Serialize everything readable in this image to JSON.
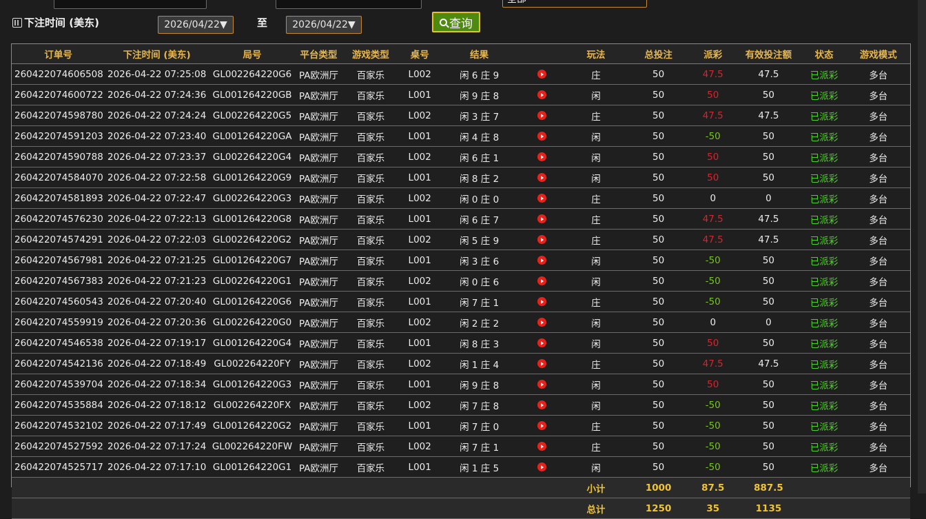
{
  "top": {
    "select_value": "全部"
  },
  "filter": {
    "date_label": "下注时间 (美东)",
    "start_date": "2026/04/22",
    "to_label": "至",
    "end_date": "2026/04/22",
    "query_label": "查询"
  },
  "columns": [
    "订单号",
    "下注时间 (美东)",
    "局号",
    "平台类型",
    "游戏类型",
    "桌号",
    "结果",
    "",
    "玩法",
    "总投注",
    "派彩",
    "有效投注额",
    "状态",
    "游戏模式"
  ],
  "rows": [
    {
      "order": "260422074606508",
      "time": "2026-04-22 07:25:08",
      "round": "GL002264220G6",
      "platform": "PA欧洲厅",
      "game": "百家乐",
      "table": "L002",
      "result": "闲 6 庄 9",
      "play": "庄",
      "bet": "50",
      "payout": "47.5",
      "payout_color": "red",
      "valid": "47.5",
      "status": "已派彩",
      "mode": "多台"
    },
    {
      "order": "260422074600722",
      "time": "2026-04-22 07:24:36",
      "round": "GL001264220GB",
      "platform": "PA欧洲厅",
      "game": "百家乐",
      "table": "L001",
      "result": "闲 9 庄 8",
      "play": "闲",
      "bet": "50",
      "payout": "50",
      "payout_color": "red",
      "valid": "50",
      "status": "已派彩",
      "mode": "多台"
    },
    {
      "order": "260422074598780",
      "time": "2026-04-22 07:24:24",
      "round": "GL002264220G5",
      "platform": "PA欧洲厅",
      "game": "百家乐",
      "table": "L002",
      "result": "闲 3 庄 7",
      "play": "庄",
      "bet": "50",
      "payout": "47.5",
      "payout_color": "red",
      "valid": "47.5",
      "status": "已派彩",
      "mode": "多台"
    },
    {
      "order": "260422074591203",
      "time": "2026-04-22 07:23:40",
      "round": "GL001264220GA",
      "platform": "PA欧洲厅",
      "game": "百家乐",
      "table": "L001",
      "result": "闲 4 庄 8",
      "play": "闲",
      "bet": "50",
      "payout": "-50",
      "payout_color": "green",
      "valid": "50",
      "status": "已派彩",
      "mode": "多台"
    },
    {
      "order": "260422074590788",
      "time": "2026-04-22 07:23:37",
      "round": "GL002264220G4",
      "platform": "PA欧洲厅",
      "game": "百家乐",
      "table": "L002",
      "result": "闲 6 庄 1",
      "play": "闲",
      "bet": "50",
      "payout": "50",
      "payout_color": "red",
      "valid": "50",
      "status": "已派彩",
      "mode": "多台"
    },
    {
      "order": "260422074584070",
      "time": "2026-04-22 07:22:58",
      "round": "GL001264220G9",
      "platform": "PA欧洲厅",
      "game": "百家乐",
      "table": "L001",
      "result": "闲 8 庄 2",
      "play": "闲",
      "bet": "50",
      "payout": "50",
      "payout_color": "red",
      "valid": "50",
      "status": "已派彩",
      "mode": "多台"
    },
    {
      "order": "260422074581893",
      "time": "2026-04-22 07:22:47",
      "round": "GL002264220G3",
      "platform": "PA欧洲厅",
      "game": "百家乐",
      "table": "L002",
      "result": "闲 0 庄 0",
      "play": "庄",
      "bet": "50",
      "payout": "0",
      "payout_color": "white",
      "valid": "0",
      "status": "已派彩",
      "mode": "多台"
    },
    {
      "order": "260422074576230",
      "time": "2026-04-22 07:22:13",
      "round": "GL001264220G8",
      "platform": "PA欧洲厅",
      "game": "百家乐",
      "table": "L001",
      "result": "闲 6 庄 7",
      "play": "庄",
      "bet": "50",
      "payout": "47.5",
      "payout_color": "red",
      "valid": "47.5",
      "status": "已派彩",
      "mode": "多台"
    },
    {
      "order": "260422074574291",
      "time": "2026-04-22 07:22:03",
      "round": "GL002264220G2",
      "platform": "PA欧洲厅",
      "game": "百家乐",
      "table": "L002",
      "result": "闲 5 庄 9",
      "play": "庄",
      "bet": "50",
      "payout": "47.5",
      "payout_color": "red",
      "valid": "47.5",
      "status": "已派彩",
      "mode": "多台"
    },
    {
      "order": "260422074567981",
      "time": "2026-04-22 07:21:25",
      "round": "GL001264220G7",
      "platform": "PA欧洲厅",
      "game": "百家乐",
      "table": "L001",
      "result": "闲 3 庄 6",
      "play": "闲",
      "bet": "50",
      "payout": "-50",
      "payout_color": "green",
      "valid": "50",
      "status": "已派彩",
      "mode": "多台"
    },
    {
      "order": "260422074567383",
      "time": "2026-04-22 07:21:23",
      "round": "GL002264220G1",
      "platform": "PA欧洲厅",
      "game": "百家乐",
      "table": "L002",
      "result": "闲 0 庄 6",
      "play": "闲",
      "bet": "50",
      "payout": "-50",
      "payout_color": "green",
      "valid": "50",
      "status": "已派彩",
      "mode": "多台"
    },
    {
      "order": "260422074560543",
      "time": "2026-04-22 07:20:40",
      "round": "GL001264220G6",
      "platform": "PA欧洲厅",
      "game": "百家乐",
      "table": "L001",
      "result": "闲 7 庄 1",
      "play": "庄",
      "bet": "50",
      "payout": "-50",
      "payout_color": "green",
      "valid": "50",
      "status": "已派彩",
      "mode": "多台"
    },
    {
      "order": "260422074559919",
      "time": "2026-04-22 07:20:36",
      "round": "GL002264220G0",
      "platform": "PA欧洲厅",
      "game": "百家乐",
      "table": "L002",
      "result": "闲 2 庄 2",
      "play": "闲",
      "bet": "50",
      "payout": "0",
      "payout_color": "white",
      "valid": "0",
      "status": "已派彩",
      "mode": "多台"
    },
    {
      "order": "260422074546538",
      "time": "2026-04-22 07:19:17",
      "round": "GL001264220G4",
      "platform": "PA欧洲厅",
      "game": "百家乐",
      "table": "L001",
      "result": "闲 8 庄 3",
      "play": "闲",
      "bet": "50",
      "payout": "50",
      "payout_color": "red",
      "valid": "50",
      "status": "已派彩",
      "mode": "多台"
    },
    {
      "order": "260422074542136",
      "time": "2026-04-22 07:18:49",
      "round": "GL002264220FY",
      "platform": "PA欧洲厅",
      "game": "百家乐",
      "table": "L002",
      "result": "闲 1 庄 4",
      "play": "庄",
      "bet": "50",
      "payout": "47.5",
      "payout_color": "red",
      "valid": "47.5",
      "status": "已派彩",
      "mode": "多台"
    },
    {
      "order": "260422074539704",
      "time": "2026-04-22 07:18:34",
      "round": "GL001264220G3",
      "platform": "PA欧洲厅",
      "game": "百家乐",
      "table": "L001",
      "result": "闲 9 庄 8",
      "play": "闲",
      "bet": "50",
      "payout": "50",
      "payout_color": "red",
      "valid": "50",
      "status": "已派彩",
      "mode": "多台"
    },
    {
      "order": "260422074535884",
      "time": "2026-04-22 07:18:12",
      "round": "GL002264220FX",
      "platform": "PA欧洲厅",
      "game": "百家乐",
      "table": "L002",
      "result": "闲 7 庄 8",
      "play": "闲",
      "bet": "50",
      "payout": "-50",
      "payout_color": "green",
      "valid": "50",
      "status": "已派彩",
      "mode": "多台"
    },
    {
      "order": "260422074532102",
      "time": "2026-04-22 07:17:49",
      "round": "GL001264220G2",
      "platform": "PA欧洲厅",
      "game": "百家乐",
      "table": "L001",
      "result": "闲 7 庄 0",
      "play": "庄",
      "bet": "50",
      "payout": "-50",
      "payout_color": "green",
      "valid": "50",
      "status": "已派彩",
      "mode": "多台"
    },
    {
      "order": "260422074527592",
      "time": "2026-04-22 07:17:24",
      "round": "GL002264220FW",
      "platform": "PA欧洲厅",
      "game": "百家乐",
      "table": "L002",
      "result": "闲 7 庄 1",
      "play": "庄",
      "bet": "50",
      "payout": "-50",
      "payout_color": "green",
      "valid": "50",
      "status": "已派彩",
      "mode": "多台"
    },
    {
      "order": "260422074525717",
      "time": "2026-04-22 07:17:10",
      "round": "GL001264220G1",
      "platform": "PA欧洲厅",
      "game": "百家乐",
      "table": "L001",
      "result": "闲 1 庄 5",
      "play": "闲",
      "bet": "50",
      "payout": "-50",
      "payout_color": "green",
      "valid": "50",
      "status": "已派彩",
      "mode": "多台"
    }
  ],
  "subtotal": {
    "label": "小计",
    "bet": "1000",
    "payout": "87.5",
    "valid": "887.5"
  },
  "total": {
    "label": "总计",
    "bet": "1250",
    "payout": "35",
    "valid": "1135"
  }
}
